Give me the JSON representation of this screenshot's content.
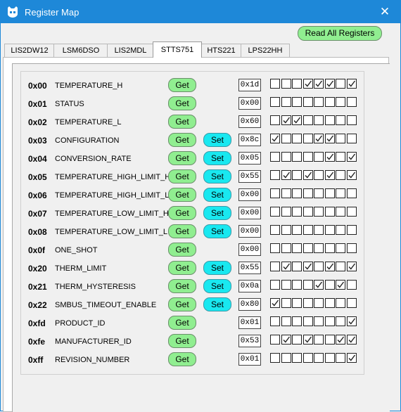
{
  "window": {
    "title": "Register Map",
    "close_glyph": "✕",
    "accent": "#1e88d8"
  },
  "toolbar": {
    "read_all_label": "Read All Registers"
  },
  "tabs": [
    {
      "label": "LIS2DW12",
      "active": false
    },
    {
      "label": "LSM6DSO",
      "active": false
    },
    {
      "label": "LIS2MDL",
      "active": false
    },
    {
      "label": "STTS751",
      "active": true
    },
    {
      "label": "HTS221",
      "active": false
    },
    {
      "label": "LPS22HH",
      "active": false
    }
  ],
  "buttons": {
    "get_label": "Get",
    "set_label": "Set",
    "get_color": "#90ee90",
    "set_color": "#19e8f0"
  },
  "registers": [
    {
      "addr": "0x00",
      "name": "TEMPERATURE_H",
      "value": "0x1d",
      "has_set": false,
      "bits": [
        0,
        0,
        0,
        1,
        1,
        1,
        0,
        1
      ]
    },
    {
      "addr": "0x01",
      "name": "STATUS",
      "value": "0x00",
      "has_set": false,
      "bits": [
        0,
        0,
        0,
        0,
        0,
        0,
        0,
        0
      ]
    },
    {
      "addr": "0x02",
      "name": "TEMPERATURE_L",
      "value": "0x60",
      "has_set": false,
      "bits": [
        0,
        1,
        1,
        0,
        0,
        0,
        0,
        0
      ]
    },
    {
      "addr": "0x03",
      "name": "CONFIGURATION",
      "value": "0x8c",
      "has_set": true,
      "bits": [
        1,
        0,
        0,
        0,
        1,
        1,
        0,
        0
      ]
    },
    {
      "addr": "0x04",
      "name": "CONVERSION_RATE",
      "value": "0x05",
      "has_set": true,
      "bits": [
        0,
        0,
        0,
        0,
        0,
        1,
        0,
        1
      ]
    },
    {
      "addr": "0x05",
      "name": "TEMPERATURE_HIGH_LIMIT_H",
      "value": "0x55",
      "has_set": true,
      "bits": [
        0,
        1,
        0,
        1,
        0,
        1,
        0,
        1
      ]
    },
    {
      "addr": "0x06",
      "name": "TEMPERATURE_HIGH_LIMIT_L",
      "value": "0x00",
      "has_set": true,
      "bits": [
        0,
        0,
        0,
        0,
        0,
        0,
        0,
        0
      ]
    },
    {
      "addr": "0x07",
      "name": "TEMPERATURE_LOW_LIMIT_H",
      "value": "0x00",
      "has_set": true,
      "bits": [
        0,
        0,
        0,
        0,
        0,
        0,
        0,
        0
      ]
    },
    {
      "addr": "0x08",
      "name": "TEMPERATURE_LOW_LIMIT_L",
      "value": "0x00",
      "has_set": true,
      "bits": [
        0,
        0,
        0,
        0,
        0,
        0,
        0,
        0
      ]
    },
    {
      "addr": "0x0f",
      "name": "ONE_SHOT",
      "value": "0x00",
      "has_set": false,
      "bits": [
        0,
        0,
        0,
        0,
        0,
        0,
        0,
        0
      ]
    },
    {
      "addr": "0x20",
      "name": "THERM_LIMIT",
      "value": "0x55",
      "has_set": true,
      "bits": [
        0,
        1,
        0,
        1,
        0,
        1,
        0,
        1
      ]
    },
    {
      "addr": "0x21",
      "name": "THERM_HYSTERESIS",
      "value": "0x0a",
      "has_set": true,
      "bits": [
        0,
        0,
        0,
        0,
        1,
        0,
        1,
        0
      ]
    },
    {
      "addr": "0x22",
      "name": "SMBUS_TIMEOUT_ENABLE",
      "value": "0x80",
      "has_set": true,
      "bits": [
        1,
        0,
        0,
        0,
        0,
        0,
        0,
        0
      ]
    },
    {
      "addr": "0xfd",
      "name": "PRODUCT_ID",
      "value": "0x01",
      "has_set": false,
      "bits": [
        0,
        0,
        0,
        0,
        0,
        0,
        0,
        1
      ]
    },
    {
      "addr": "0xfe",
      "name": "MANUFACTURER_ID",
      "value": "0x53",
      "has_set": false,
      "bits": [
        0,
        1,
        0,
        1,
        0,
        0,
        1,
        1
      ]
    },
    {
      "addr": "0xff",
      "name": "REVISION_NUMBER",
      "value": "0x01",
      "has_set": false,
      "bits": [
        0,
        0,
        0,
        0,
        0,
        0,
        0,
        1
      ]
    }
  ]
}
